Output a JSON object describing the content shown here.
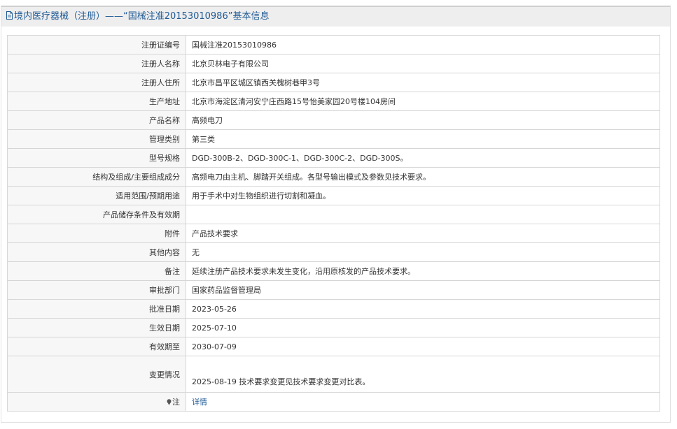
{
  "header": {
    "title": "境内医疗器械（注册）——“国械注准20153010986”基本信息",
    "icon": "document-icon"
  },
  "rows": [
    {
      "label": "注册证编号",
      "value": "国械注准20153010986"
    },
    {
      "label": "注册人名称",
      "value": "北京贝林电子有限公司"
    },
    {
      "label": "注册人住所",
      "value": "北京市昌平区城区镇西关槐树巷甲3号"
    },
    {
      "label": "生产地址",
      "value": "北京市海淀区清河安宁庄西路15号怡美家园20号楼104房间"
    },
    {
      "label": "产品名称",
      "value": "高频电刀"
    },
    {
      "label": "管理类别",
      "value": "第三类"
    },
    {
      "label": "型号规格",
      "value": "DGD-300B-2、DGD-300C-1、DGD-300C-2、DGD-300S。"
    },
    {
      "label": "结构及组成/主要组成成分",
      "value": "高频电刀由主机、脚踏开关组成。各型号输出模式及参数见技术要求。"
    },
    {
      "label": "适用范围/预期用途",
      "value": "用于手术中对生物组织进行切割和凝血。"
    },
    {
      "label": "产品储存条件及有效期",
      "value": ""
    },
    {
      "label": "附件",
      "value": "产品技术要求"
    },
    {
      "label": "其他内容",
      "value": "无"
    },
    {
      "label": "备注",
      "value": "延续注册产品技术要求未发生变化，沿用原核发的产品技术要求。"
    },
    {
      "label": "审批部门",
      "value": "国家药品监督管理局"
    },
    {
      "label": "批准日期",
      "value": "2023-05-26"
    },
    {
      "label": "生效日期",
      "value": "2025-07-10"
    },
    {
      "label": "有效期至",
      "value": "2030-07-09"
    },
    {
      "label": "变更情况",
      "value": "2025-08-19 技术要求变更见技术要求变更对比表。"
    }
  ],
  "note_row": {
    "label": "注",
    "icon": "pin-icon",
    "link": "详情"
  },
  "colors": {
    "header_text": "#1f5a96",
    "header_bg": "#eeeeee",
    "label_bg": "#f7f7f7",
    "border": "#d6d6d6",
    "link": "#1f5a96"
  }
}
